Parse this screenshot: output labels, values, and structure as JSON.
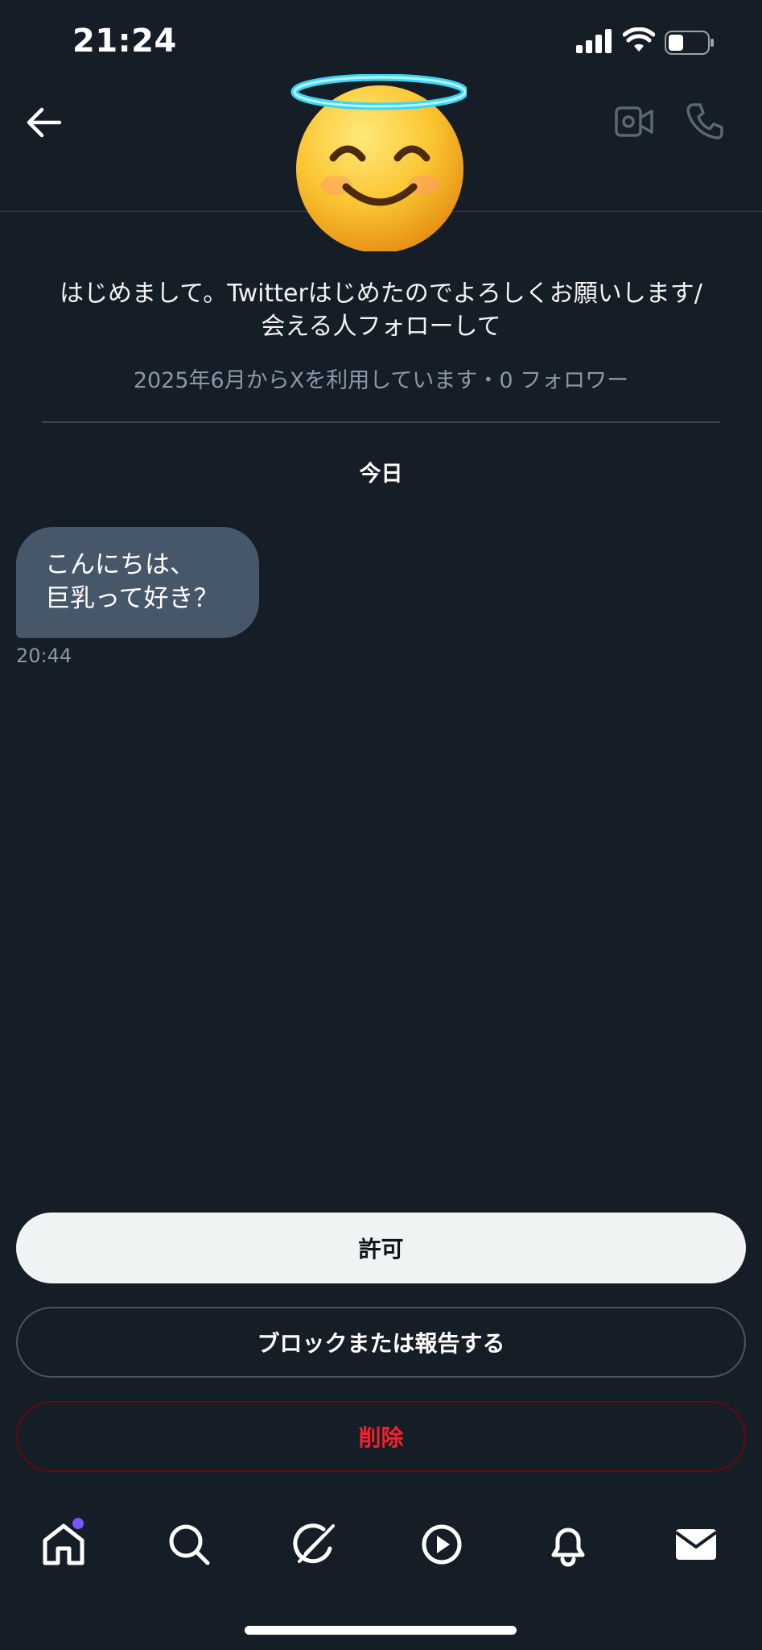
{
  "status_bar": {
    "time": "21:24"
  },
  "header": {
    "back_icon": "arrow-left-icon",
    "video_icon": "video-camera-icon",
    "phone_icon": "phone-icon",
    "avatar": "smiling-face-with-halo-emoji"
  },
  "profile": {
    "bio": "はじめまして。Twitterはじめたのでよろしくお願いします/会える人フォローして",
    "joined": "2025年6月からXを利用しています・0 フォロワー"
  },
  "conversation": {
    "date_separator": "今日",
    "messages": [
      {
        "text": "こんにちは、\n巨乳って好き？",
        "time": "20:44"
      }
    ]
  },
  "actions": {
    "allow": "許可",
    "block_or_report": "ブロックまたは報告する",
    "delete": "削除"
  },
  "bottom_nav": {
    "items": [
      "home-icon",
      "search-icon",
      "grok-icon",
      "video-play-icon",
      "notifications-bell-icon",
      "messages-envelope-icon"
    ]
  },
  "colors": {
    "background": "#151d27",
    "bubble": "#47576a",
    "delete_red": "#f4212e",
    "notification_dot": "#7856ff"
  }
}
